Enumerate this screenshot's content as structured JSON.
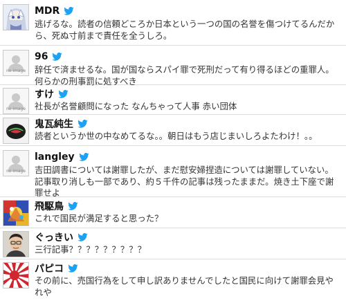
{
  "tweets": [
    {
      "user": "MDR",
      "avatar": "anime-avatar",
      "text": "逃げるな。読者の信頼どころか日本という一つの国の名誉を傷つけてるんだから、死ぬ寸前まで責任を全うしろ。"
    },
    {
      "user": "96",
      "avatar": "no-image-avatar",
      "avatar_label": "no image",
      "text": "辞任で済ませるな。国が国ならスパイ罪で死刑だって有り得るほどの重罪人。何らかの刑事罰に処すべき"
    },
    {
      "user": "すけ",
      "avatar": "no-image-avatar",
      "avatar_label": "no image",
      "text": "社長が名誉顧問になった なんちゃって人事 赤い団体"
    },
    {
      "user": "鬼瓦純生",
      "avatar": "watermelon-avatar",
      "text": "読者というか世の中なめてるな。。朝日はもう店じまいしろよたわけ！。。"
    },
    {
      "user": "langley",
      "avatar": "no-image-avatar",
      "avatar_label": "no image",
      "text": "吉田調書については謝罪したが、まだ慰安婦捏造については謝罪していない。記事取り消しも一部であり、約５千件の記事は残ったままだ。焼き土下座で謝罪せよ"
    },
    {
      "user": "飛駆鳥",
      "avatar": "colorful-avatar",
      "text": "これで国民が満足すると思った？"
    },
    {
      "user": "ぐっきい",
      "avatar": "person-photo-avatar",
      "text": "三行記事？？？？？？？？？"
    },
    {
      "user": "パピコ",
      "avatar": "rising-sun-flag-avatar",
      "text": "その前に、売国行為をして申し訳ありませんでしたと国民に向けて謝罪会見やれや"
    }
  ],
  "colors": {
    "twitter_blue": "#1da1f2",
    "divider": "#dcdcdc",
    "text": "#333333"
  }
}
